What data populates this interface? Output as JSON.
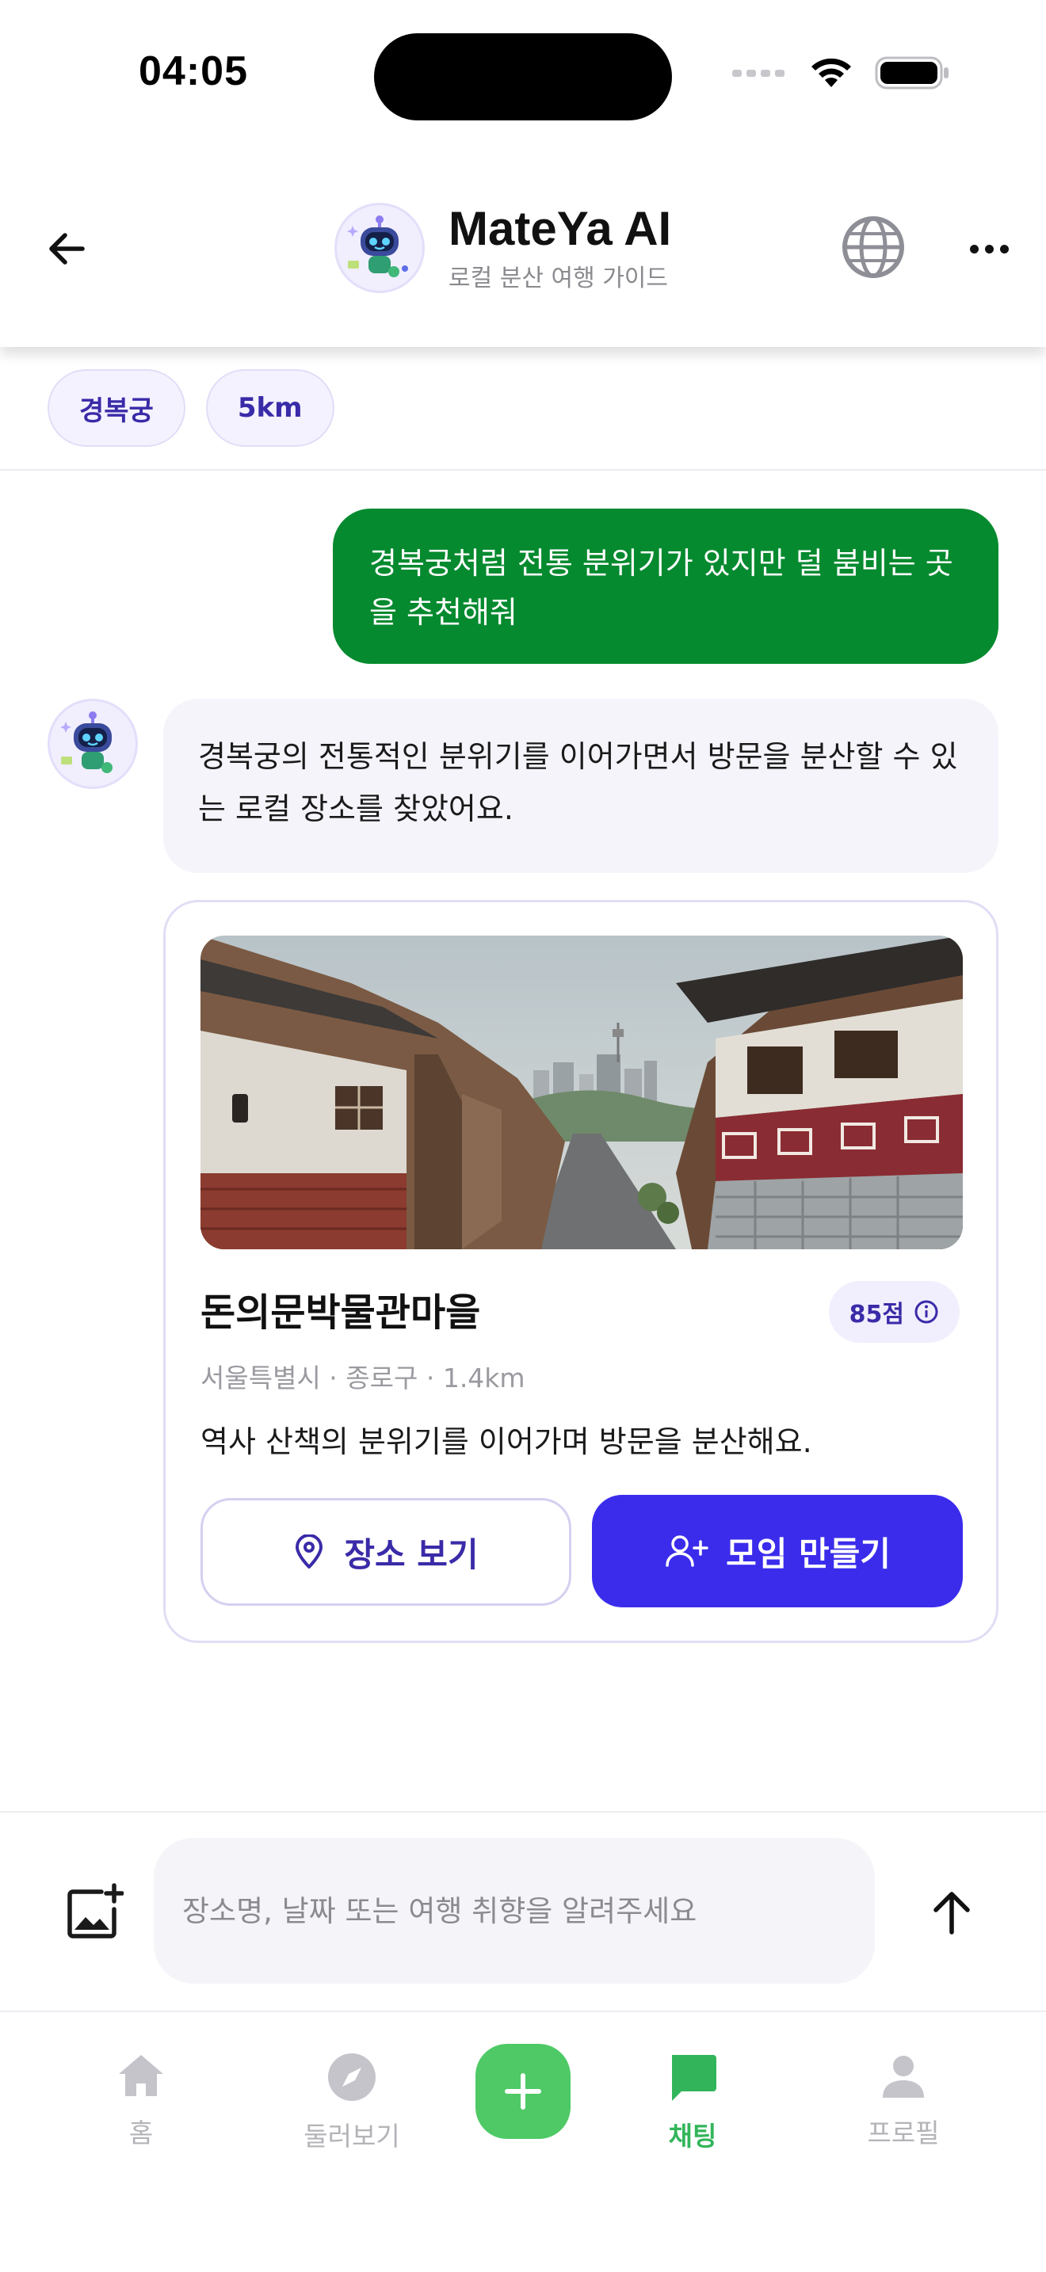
{
  "status_bar": {
    "time": "04:05"
  },
  "header": {
    "title": "MateYa AI",
    "subtitle": "로컬 분산 여행 가이드",
    "icons": {
      "back": "arrow-left-icon",
      "language": "globe-icon",
      "more": "more-horizontal-icon"
    }
  },
  "chips": [
    {
      "label": "경복궁"
    },
    {
      "label": "5km"
    }
  ],
  "messages": {
    "user": "경복궁처럼 전통 분위기가 있지만 덜 붐비는 곳을 추천해줘",
    "bot": "경복궁의 전통적인 분위기를 이어가면서 방문을 분산할 수 있는 로컬 장소를 찾았어요."
  },
  "place_card": {
    "name": "돈의문박물관마을",
    "score": "85점",
    "meta": "서울특별시 · 종로구 · 1.4km",
    "description": "역사 산책의 분위기를 이어가며 방문을 분산해요.",
    "view_button": "장소 보기",
    "create_button": "모임 만들기"
  },
  "composer": {
    "placeholder": "장소명, 날짜 또는 여행 취향을 알려주세요"
  },
  "bottom_nav": {
    "items": [
      {
        "label": "홈",
        "icon": "home-icon"
      },
      {
        "label": "둘러보기",
        "icon": "compass-icon"
      },
      {
        "label": "채팅",
        "icon": "chat-icon",
        "active": true
      },
      {
        "label": "프로필",
        "icon": "profile-icon"
      }
    ]
  },
  "colors": {
    "brand_purple": "#3b2cec",
    "user_bubble": "#068a2f",
    "active_green": "#32b55a",
    "fab_green": "#4ec966"
  }
}
